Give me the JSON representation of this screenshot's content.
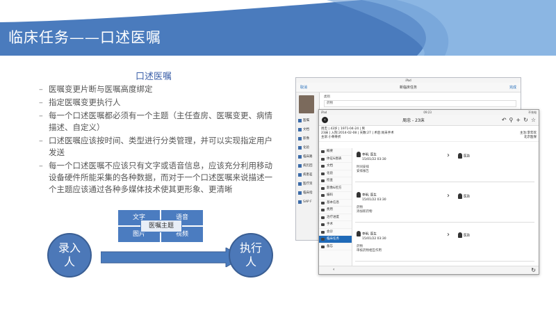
{
  "header": {
    "title": "临床任务——口述医嘱"
  },
  "subtitle": "口述医嘱",
  "bullets": [
    "医嘱变更片断与医嘱高度绑定",
    "指定医嘱变更执行人",
    "每一个口述医嘱都必须有一个主题（主任查房、医嘱变更、病情描述、自定义）",
    "口述医嘱应该按时间、类型进行分类管理，并可以实现指定用户发送",
    "每一个口述医嘱不应该只有文字或语音信息，应该充分利用移动设备硬件所能采集的各种数据，而对于一个口述医嘱来说描述一个主题应该通过各种多媒体技术使其更形象、更清晰"
  ],
  "diagram": {
    "cells": [
      "文字",
      "语音",
      "图片",
      "视频"
    ],
    "center": "医嘱主题",
    "left_circle": "录入人",
    "right_circle": "执行人"
  },
  "colors": {
    "accent": "#4b7cc0",
    "header_dark": "#4a7bbd",
    "header_light": "#8bb6e3"
  },
  "tablet_back": {
    "status": "iPad",
    "cancel": "取消",
    "title": "新临床任务",
    "done": "完成",
    "type_label": "类别",
    "type_value": "药物",
    "sidebar": [
      "医嘱",
      "文档",
      "影像",
      "化验",
      "临床路",
      "病历回",
      "病患差",
      "医疗资",
      "临床指",
      "SAP F"
    ]
  },
  "tablet_front": {
    "status_left": "iPad",
    "status_time": "09:23",
    "status_right": "不充电",
    "title": "周忠 - 23床",
    "patient_line1": "周忠 | 43岁 | 1971-04-24 | 男",
    "patient_line2": "23床 | 入院:2014-02-08 | 天数:27 | 术后:尚未手术",
    "attending": "主治:李年欢",
    "diagnosis": "主诉:小骨骨折",
    "department": "北京医保",
    "sidebar": [
      "概要",
      "体征&图表",
      "文档",
      "化验",
      "检查",
      "影像&检方",
      "编码",
      "基本信息",
      "费用",
      "治疗进度",
      "手术",
      "会诊",
      "临床任务",
      "备忘"
    ],
    "active_item": "临床任务",
    "cards": [
      {
        "who": "李明, 医生",
        "time": "15/01/22 03:30",
        "role": "医助",
        "label": "时间安排",
        "text": "安排报告"
      },
      {
        "who": "李明, 医生",
        "time": "15/01/22 03:30",
        "role": "医助",
        "label": "药物",
        "text": "添加新药物"
      },
      {
        "who": "李明, 医生",
        "time": "15/01/22 03:30",
        "role": "医助",
        "label": "药物",
        "text": "审核药物相互作用"
      }
    ]
  }
}
